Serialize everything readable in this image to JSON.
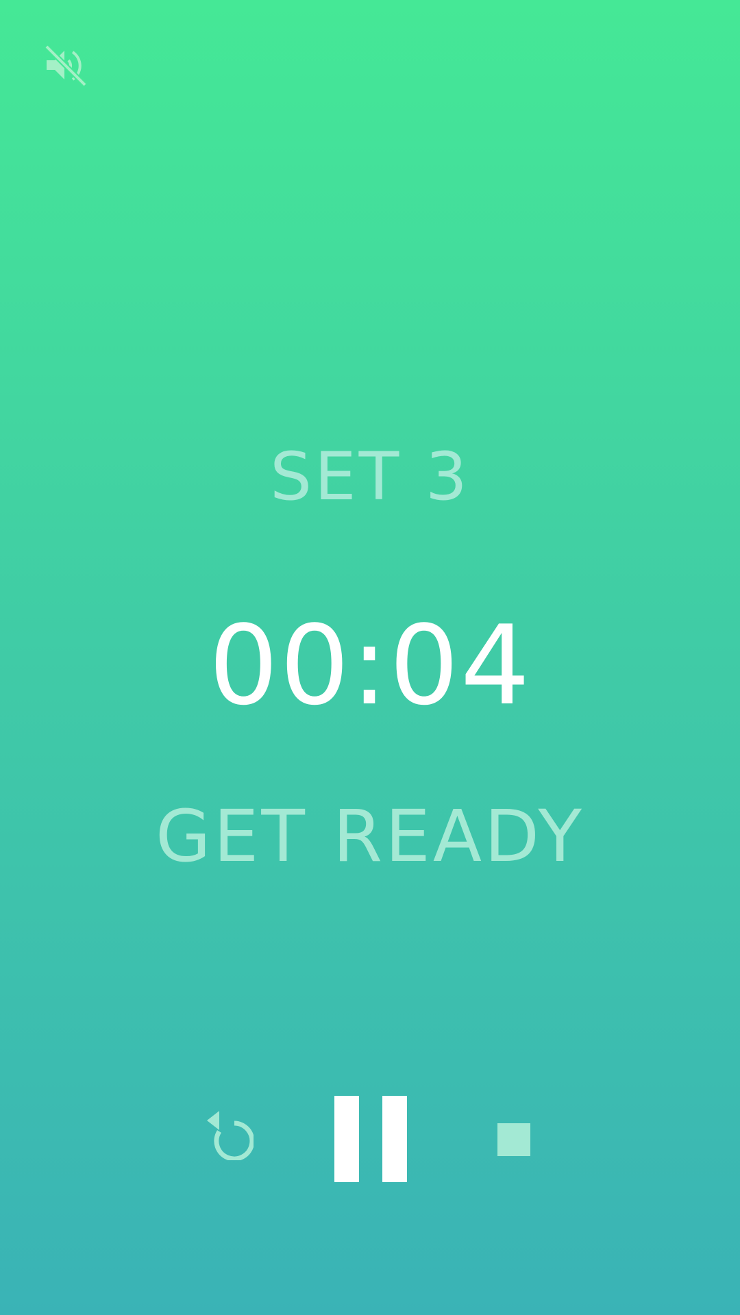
{
  "header": {
    "mute_icon": "volume-muted-icon"
  },
  "workout": {
    "set_label": "SET 3",
    "timer": "00:04",
    "phase": "GET READY"
  },
  "controls": {
    "restart_icon": "restart-icon",
    "pause_icon": "pause-icon",
    "stop_icon": "stop-icon"
  },
  "colors": {
    "gradient_top": "#45e896",
    "gradient_bottom": "#3ab3b6",
    "label_color": "#a3e9d4",
    "timer_color": "#ffffff",
    "muted_icon_color": "#a4f0c6"
  }
}
